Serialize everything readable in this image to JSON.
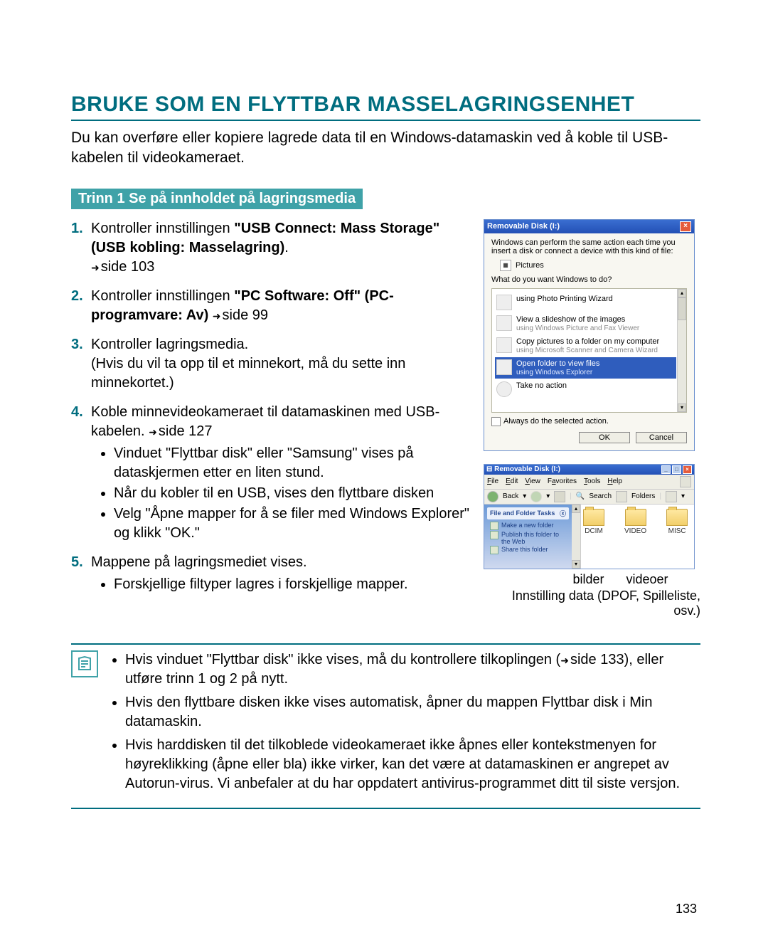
{
  "title": "BRUKE SOM EN FLYTTBAR MASSELAGRINGSENHET",
  "intro": "Du kan overføre eller kopiere lagrede data til en Windows-datamaskin ved å koble til USB-kabelen til videokameraet.",
  "step_header": "Trinn 1 Se på innholdet på lagringsmedia",
  "steps": {
    "s1a": "Kontroller innstillingen ",
    "s1b": "\"USB Connect: Mass Storage\" (USB kobling: Masselagring)",
    "s1c": ".",
    "s1_ref": "side 103",
    "s2a": "Kontroller innstillingen ",
    "s2b": "\"PC Software: Off\" (PC-programvare: Av)",
    "s2_ref": "side 99",
    "s3a": "Kontroller lagringsmedia.",
    "s3b": "(Hvis du vil ta opp til et minnekort, må du sette inn minnekortet.)",
    "s4a": "Koble minnevideokameraet til datamaskinen med USB-kabelen. ",
    "s4_ref": "side 127",
    "s4_b1": "Vinduet \"Flyttbar disk\" eller \"Samsung\" vises på dataskjermen etter en liten stund.",
    "s4_b2": "Når du kobler til en USB, vises den flyttbare disken",
    "s4_b3": "Velg \"Åpne mapper for å se filer med Windows Explorer\" og klikk \"OK.\"",
    "s5a": "Mappene på lagringsmediet vises.",
    "s5_b1": "Forskjellige filtyper lagres i forskjellige mapper."
  },
  "dialog": {
    "title": "Removable Disk (I:)",
    "desc": "Windows can perform the same action each time you insert a disk or connect a device with this kind of file:",
    "pictures": "Pictures",
    "question": "What do you want Windows to do?",
    "opt1": "using Photo Printing Wizard",
    "opt2a": "View a slideshow of the images",
    "opt2b": "using Windows Picture and Fax Viewer",
    "opt3a": "Copy pictures to a folder on my computer",
    "opt3b": "using Microsoft Scanner and Camera Wizard",
    "opt4a": "Open folder to view files",
    "opt4b": "using Windows Explorer",
    "opt5": "Take no action",
    "always": "Always do the selected action.",
    "ok": "OK",
    "cancel": "Cancel"
  },
  "explorer": {
    "title": "Removable Disk (I:)",
    "menu": {
      "file": "File",
      "edit": "Edit",
      "view": "View",
      "fav": "Favorites",
      "tools": "Tools",
      "help": "Help"
    },
    "tool": {
      "back": "Back",
      "search": "Search",
      "folders": "Folders"
    },
    "side_title": "File and Folder Tasks",
    "side1": "Make a new folder",
    "side2": "Publish this folder to the Web",
    "side3": "Share this folder",
    "folders": {
      "dcim": "DCIM",
      "video": "VIDEO",
      "misc": "MISC"
    }
  },
  "labels": {
    "bilder": "bilder",
    "videoer": "videoer"
  },
  "sub_note": "Innstilling data (DPOF, Spilleliste, osv.)",
  "notes": {
    "n1a": "Hvis vinduet \"Flyttbar disk\" ikke vises, må du kontrollere tilkoplingen (",
    "n1_ref": "side 133",
    "n1b": "), eller utføre trinn 1 og 2 på nytt.",
    "n2": "Hvis den flyttbare disken ikke vises automatisk, åpner du mappen Flyttbar disk i Min datamaskin.",
    "n3": "Hvis harddisken til det tilkoblede videokameraet ikke åpnes eller kontekstmenyen for høyreklikking (åpne eller bla) ikke virker, kan det være at datamaskinen er angrepet av Autorun-virus. Vi anbefaler at du har oppdatert antivirus-programmet ditt til siste versjon."
  },
  "page_number": "133"
}
